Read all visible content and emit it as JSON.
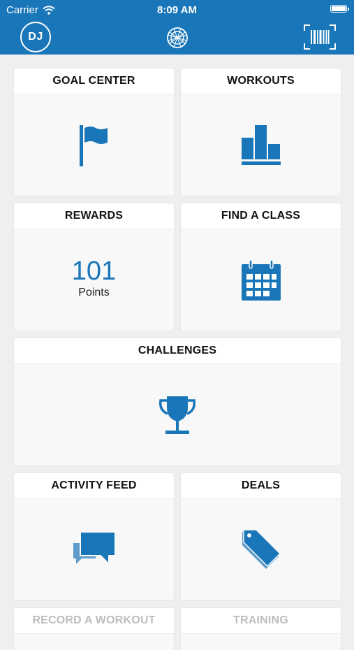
{
  "status_bar": {
    "carrier": "Carrier",
    "time": "8:09 AM"
  },
  "header": {
    "avatar_initials": "DJ",
    "logo_icon": "globe-logo-icon",
    "barcode_icon": "barcode-scan-icon"
  },
  "colors": {
    "brand": "#1976b8",
    "background": "#efeff0",
    "tile": "#f8f8f8"
  },
  "tiles": {
    "goal_center": {
      "title": "GOAL CENTER",
      "icon": "flag-icon"
    },
    "workouts": {
      "title": "WORKOUTS",
      "icon": "bar-chart-icon"
    },
    "rewards": {
      "title": "REWARDS",
      "points": "101",
      "points_label": "Points"
    },
    "find_a_class": {
      "title": "FIND A CLASS",
      "icon": "calendar-icon"
    },
    "challenges": {
      "title": "CHALLENGES",
      "icon": "trophy-icon"
    },
    "activity_feed": {
      "title": "ACTIVITY FEED",
      "icon": "chat-bubbles-icon"
    },
    "deals": {
      "title": "DEALS",
      "icon": "tags-icon"
    },
    "record_a_workout": {
      "title": "RECORD A WORKOUT"
    },
    "training": {
      "title": "TRAINING"
    }
  }
}
